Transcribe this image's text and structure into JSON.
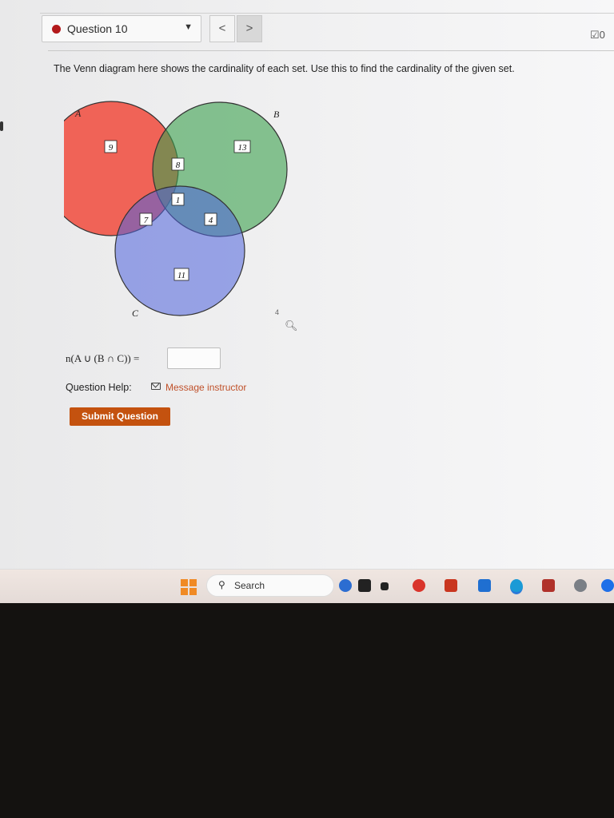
{
  "header": {
    "question_label": "Question 10",
    "prev_symbol": "<",
    "next_symbol": ">",
    "status_text": "0"
  },
  "prompt": "The Venn diagram here shows the cardinality of each set. Use this to find the cardinality of the given set.",
  "venn": {
    "set_labels": {
      "a": "A",
      "b": "B",
      "c": "C"
    },
    "regions": {
      "a_only": "9",
      "b_only": "13",
      "a_and_b_only": "8",
      "a_b_c": "1",
      "a_and_c_only": "7",
      "b_and_c_only": "4",
      "c_only": "11"
    },
    "colors": {
      "a": "#f0574a",
      "b": "#3aa04c",
      "c": "#4f62dc"
    },
    "stray_mark": "4"
  },
  "question": {
    "expression": "n(A ∪ (B ∩ C)) =",
    "answer_value": "",
    "help_label": "Question Help:",
    "help_link": "Message instructor",
    "submit_label": "Submit Question"
  },
  "taskbar": {
    "search_label": "Search"
  }
}
